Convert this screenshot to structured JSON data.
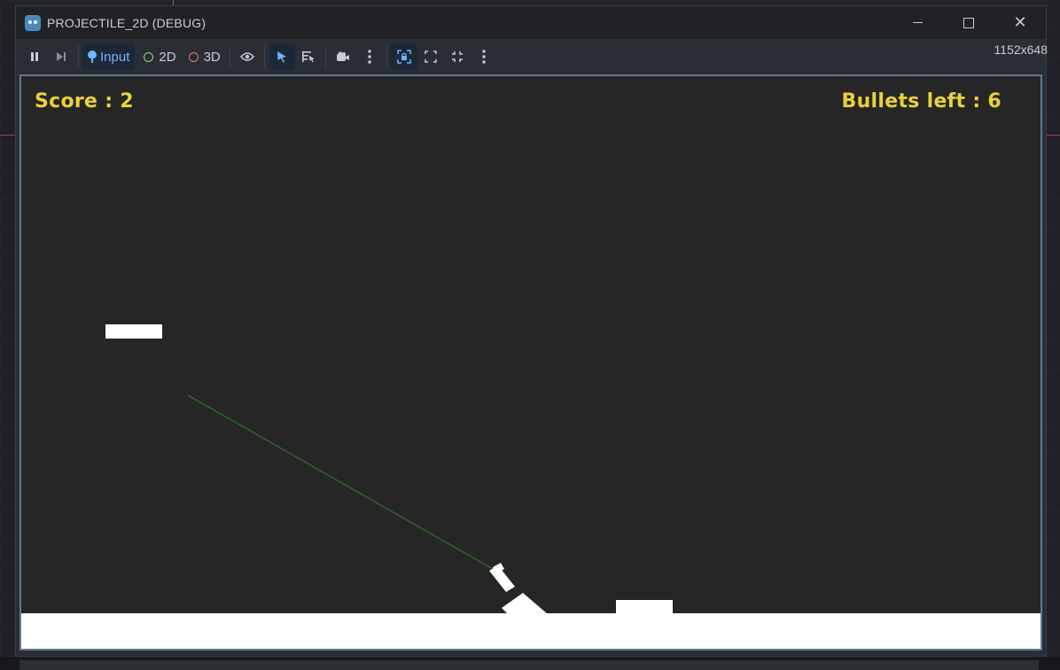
{
  "window": {
    "title": "PROJECTILE_2D (DEBUG)",
    "resolution": "1152x648"
  },
  "toolbar": {
    "input_label": "Input",
    "mode_2d_label": "2D",
    "mode_3d_label": "3D"
  },
  "game": {
    "score_text": "Score : 2",
    "bullets_text": "Bullets left : 6"
  },
  "colors": {
    "hud_text": "#e9d23a",
    "background": "#262626",
    "trajectory": "#2f6b2a",
    "accent": "#6fb4ff"
  }
}
